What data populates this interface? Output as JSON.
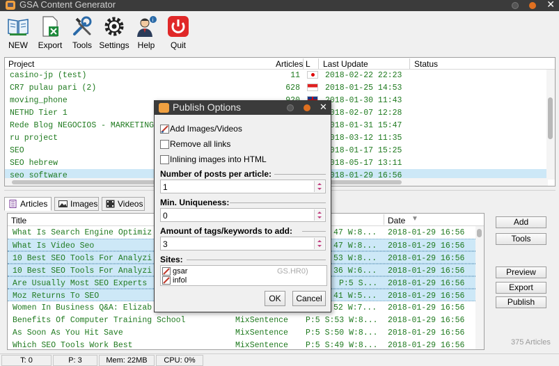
{
  "app": {
    "title": "GSA Content Generator"
  },
  "toolbar": {
    "new_label": "NEW",
    "export_label": "Export",
    "tools_label": "Tools",
    "settings_label": "Settings",
    "help_label": "Help",
    "quit_label": "Quit"
  },
  "projects": {
    "columns": {
      "project": "Project",
      "articles": "Articles",
      "lang": "L",
      "last_update": "Last Update",
      "status": "Status"
    },
    "rows": [
      {
        "name": "casino-jp (test)",
        "articles": "11",
        "flag": "jp",
        "date": "2018-02-22 22:23"
      },
      {
        "name": "CR7 pulau pari (2)",
        "articles": "628",
        "flag": "id",
        "date": "2018-01-25 14:53"
      },
      {
        "name": "moving_phone",
        "articles": "920",
        "flag": "gb",
        "date": "2018-01-30 11:43"
      },
      {
        "name": "NETHD Tier 1",
        "articles": "",
        "flag": "",
        "date": "2018-02-07 12:28"
      },
      {
        "name": "Rede Blog NEGOCIOS - MARKETING",
        "articles": "",
        "flag": "",
        "date": "2018-01-31 15:47"
      },
      {
        "name": "ru project",
        "articles": "",
        "flag": "",
        "date": "2018-03-12 11:35"
      },
      {
        "name": "SEO",
        "articles": "",
        "flag": "",
        "date": "2018-01-17 15:25"
      },
      {
        "name": "SEO hebrew",
        "articles": "",
        "flag": "",
        "date": "2018-05-17 13:11"
      },
      {
        "name": "seo software",
        "articles": "",
        "flag": "",
        "date": "2018-01-29 16:56"
      }
    ]
  },
  "tabs": {
    "articles": "Articles",
    "images": "Images",
    "videos": "Videos"
  },
  "articles": {
    "columns": {
      "title": "Title",
      "date": "Date"
    },
    "rows": [
      {
        "title": "What Is Search Engine Optimiz",
        "source": "",
        "stats": "47 W:8...",
        "date": "2018-01-29 16:56",
        "selected": false
      },
      {
        "title": "What Is Video Seo",
        "source": "",
        "stats": "47 W:8...",
        "date": "2018-01-29 16:56",
        "selected": true
      },
      {
        "title": "10 Best SEO Tools For Analyzi",
        "source": "",
        "stats": "53 W:8...",
        "date": "2018-01-29 16:56",
        "selected": true
      },
      {
        "title": "10 Best SEO Tools For Analyzi",
        "source": "",
        "stats": "36 W:6...",
        "date": "2018-01-29 16:56",
        "selected": true
      },
      {
        "title": "Are Usually Most SEO Experts",
        "source": "",
        "stats": "P:5 S...",
        "date": "2018-01-29 16:56",
        "selected": true
      },
      {
        "title": "Moz Returns To SEO",
        "source": "",
        "stats": "41 W:5...",
        "date": "2018-01-29 16:56",
        "selected": true
      },
      {
        "title": "Women In Business Q&A: Elizab",
        "source": "",
        "stats": "52 W:7...",
        "date": "2018-01-29 16:56",
        "selected": false
      },
      {
        "title": "Benefits Of Computer Training School",
        "source": "MixSentence",
        "stats": "P:5 S:53 W:8...",
        "date": "2018-01-29 16:56",
        "selected": false
      },
      {
        "title": "As Soon As You Hit Save",
        "source": "MixSentence",
        "stats": "P:5 S:50 W:8...",
        "date": "2018-01-29 16:56",
        "selected": false
      },
      {
        "title": "Which SEO Tools Work Best",
        "source": "MixSentence",
        "stats": "P:5 S:49 W:8...",
        "date": "2018-01-29 16:56",
        "selected": false
      }
    ],
    "count_label": "375 Articles"
  },
  "side_buttons": {
    "add": "Add",
    "tools": "Tools",
    "preview": "Preview",
    "export": "Export",
    "publish": "Publish"
  },
  "statusbar": {
    "threads": "T: 0",
    "projects": "P: 3",
    "mem": "Mem: 22MB",
    "cpu": "CPU: 0%"
  },
  "dialog": {
    "title": "Publish Options",
    "add_images_videos": "Add Images/Videos",
    "remove_all_links": "Remove all links",
    "inline_images": "Inlining images into HTML",
    "posts_label": "Number of posts per article:",
    "posts_value": "1",
    "uniqueness_label": "Min. Uniqueness:",
    "uniqueness_value": "0",
    "tags_label": "Amount of tags/keywords to add:",
    "tags_value": "3",
    "sites_label": "Sites:",
    "sites": [
      {
        "name": "gsar",
        "extra": "GS.HR0)"
      },
      {
        "name": "infol",
        "extra": ""
      }
    ],
    "ok_label": "OK",
    "cancel_label": "Cancel"
  },
  "colors": {
    "text_green": "#1f7a1f",
    "selection": "#cde8f7",
    "titlebar": "#3b3b3b",
    "quit_red": "#e02828"
  }
}
